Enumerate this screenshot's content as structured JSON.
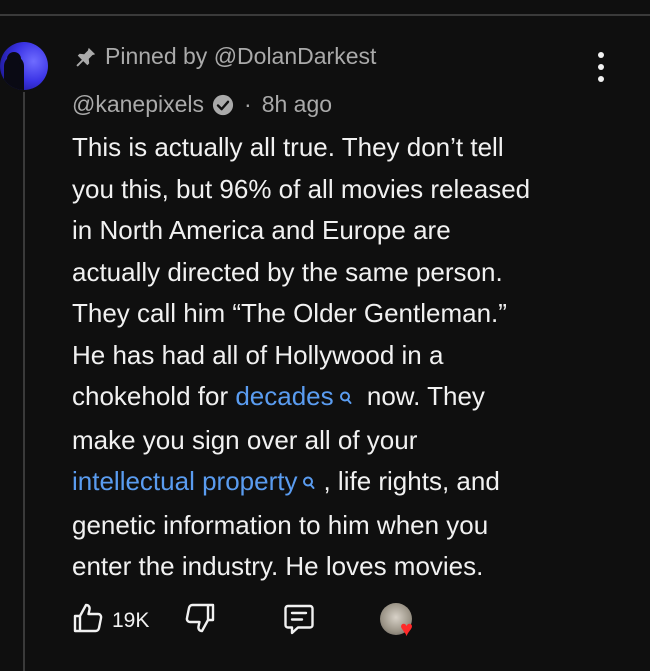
{
  "comment": {
    "pinned_label": "Pinned by @DolanDarkest",
    "author": "@kanepixels",
    "separator": "·",
    "timestamp": "8h ago",
    "body": {
      "line1": "This is actually all true. They don’t tell",
      "line2": "you this, but 96% of all movies released",
      "line3": "in North America and Europe are",
      "line4": "actually directed by the same person.",
      "line5": "They call him “The Older Gentleman.”",
      "line6": "He has had all of Hollywood in a",
      "line7_pre": "chokehold for ",
      "line7_link": "decades",
      "line7_post": " now. They",
      "line8": "make you sign over all of your",
      "line9_link": "intellectual property",
      "line9_post": ", life rights, and",
      "line10": "genetic information to him when you",
      "line11": "enter the industry. He loves movies."
    },
    "actions": {
      "like_count": "19K"
    }
  },
  "colors": {
    "background": "#0f0f0f",
    "text": "#f1f1f1",
    "secondary_text": "#aaaaaa",
    "link": "#5a9cf0",
    "heart": "#ff2a2a"
  },
  "icons": {
    "pin": "pin-icon",
    "more": "more-vertical-icon",
    "verified": "verified-check-icon",
    "link_search": "search-icon",
    "like": "thumbs-up-icon",
    "dislike": "thumbs-down-icon",
    "reply": "reply-icon",
    "creator_heart": "creator-heart-icon"
  }
}
